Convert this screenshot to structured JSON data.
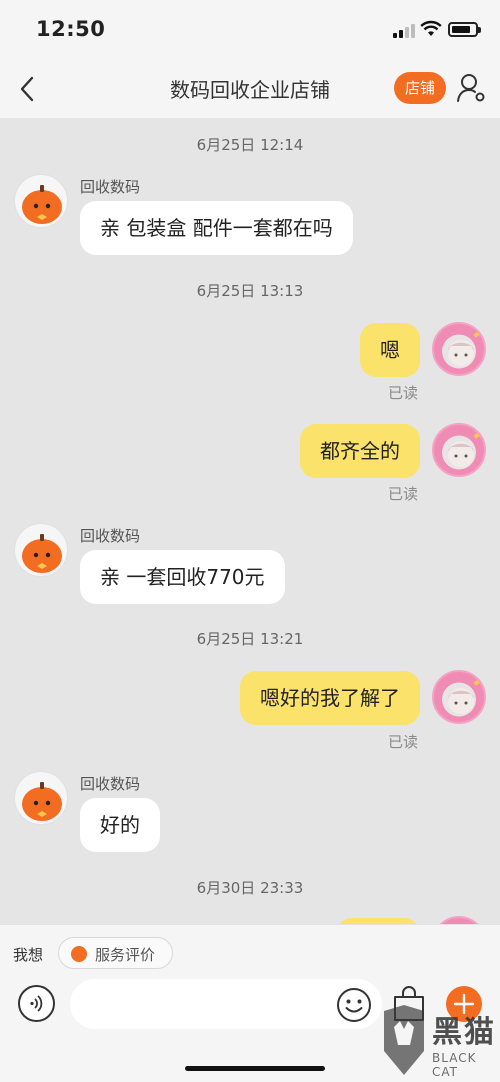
{
  "status_bar": {
    "time": "12:50"
  },
  "nav": {
    "title": "数码回收企业店铺",
    "shop_button": "店铺"
  },
  "chat": {
    "timestamps": [
      "6月25日 12:14",
      "6月25日 13:13",
      "6月25日 13:21",
      "6月30日 23:33"
    ],
    "shop_name": "回收数码",
    "messages": [
      {
        "side": "left",
        "text": "亲 包装盒 配件一套都在吗"
      },
      {
        "side": "right",
        "text": "嗯",
        "status": "已读"
      },
      {
        "side": "right",
        "text": "都齐全的",
        "status": "已读"
      },
      {
        "side": "left",
        "text": "亲 一套回收770元"
      },
      {
        "side": "right",
        "text": "嗯好的我了解了",
        "status": "已读"
      },
      {
        "side": "left",
        "text": "好的"
      }
    ]
  },
  "bottom": {
    "suggest_label": "我想",
    "review_chip": "服务评价",
    "input_placeholder": ""
  },
  "watermark": {
    "text": "黑猫",
    "sub": "BLACK CAT"
  },
  "colors": {
    "accent": "#f26c21",
    "right_bubble": "#fbe26b",
    "left_bubble": "#ffffff",
    "background": "#e5e5e5"
  }
}
